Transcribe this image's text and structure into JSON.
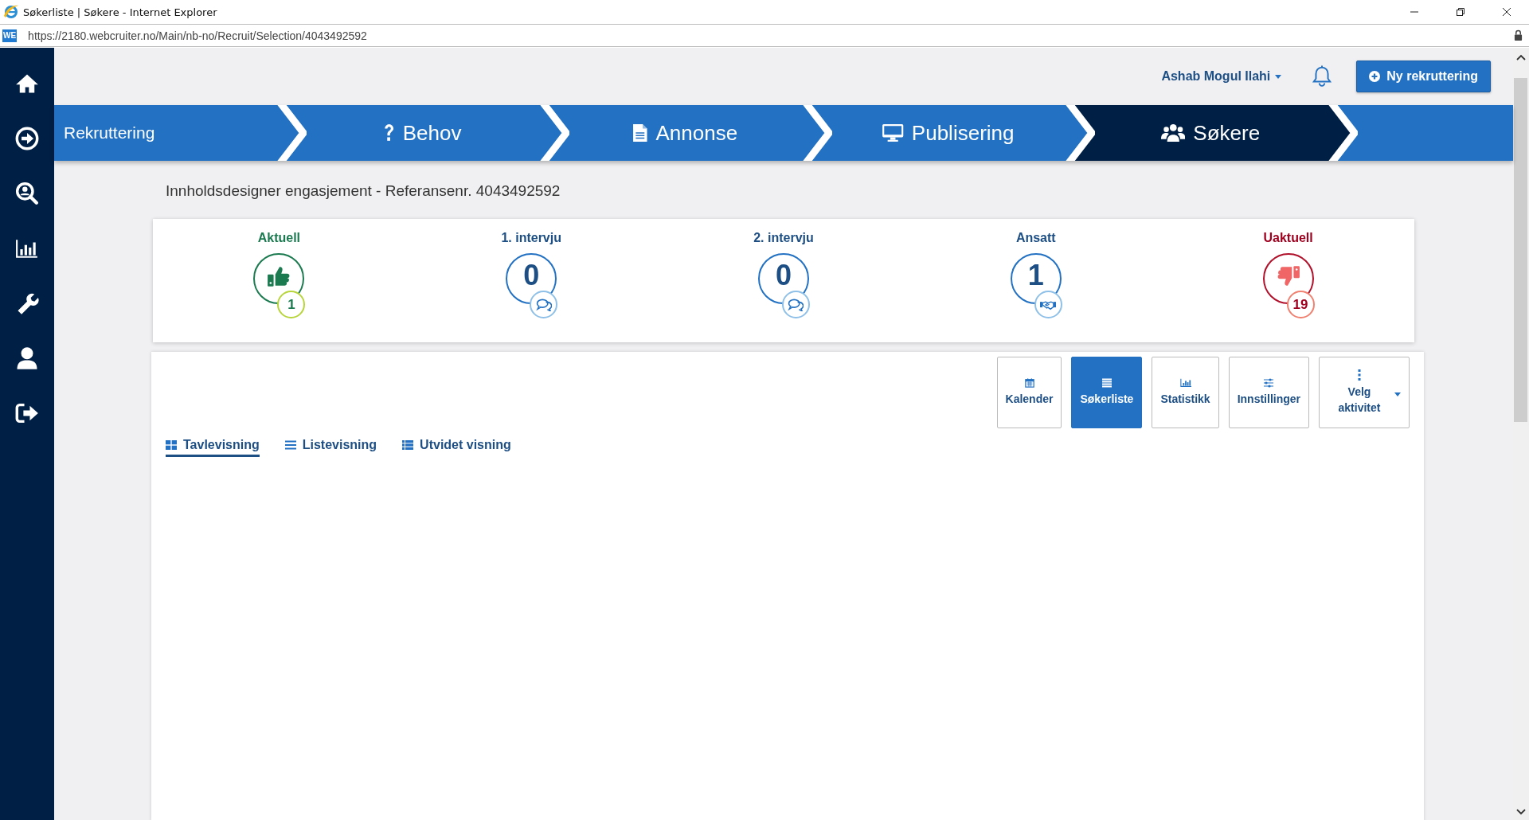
{
  "window": {
    "title": "Søkerliste | Søkere - Internet Explorer"
  },
  "address_bar": {
    "favicon": "WE",
    "url": "https://2180.webcruiter.no/Main/nb-no/Recruit/Selection/4043492592"
  },
  "header": {
    "user_name": "Ashab Mogul Ilahi",
    "new_button": "Ny rekruttering"
  },
  "pipeline": [
    {
      "label": "Rekruttering",
      "selected": false
    },
    {
      "label": "Behov",
      "selected": false
    },
    {
      "label": "Annonse",
      "selected": false
    },
    {
      "label": "Publisering",
      "selected": false
    },
    {
      "label": "Søkere",
      "selected": true
    }
  ],
  "page_title": "Innholdsdesigner engasjement - Referansenr. 4043492592",
  "stages": [
    {
      "label": "Aktuell",
      "kind": "positive",
      "value": "1",
      "color": "#1b7a4f"
    },
    {
      "label": "1. intervju",
      "kind": "interview",
      "value": "0",
      "color": "#1d4f85"
    },
    {
      "label": "2. intervju",
      "kind": "interview",
      "value": "0",
      "color": "#1d4f85"
    },
    {
      "label": "Ansatt",
      "kind": "hired",
      "value": "1",
      "color": "#1d4f85"
    },
    {
      "label": "Uaktuell",
      "kind": "negative",
      "value": "19",
      "color": "#a0001e"
    }
  ],
  "toolbar": [
    {
      "label": "Kalender",
      "selected": false,
      "kind": "button"
    },
    {
      "label": "Søkerliste",
      "selected": true,
      "kind": "button"
    },
    {
      "label": "Statistikk",
      "selected": false,
      "kind": "button"
    },
    {
      "label": "Innstillinger",
      "selected": false,
      "kind": "button"
    },
    {
      "label": "Velg aktivitet",
      "selected": false,
      "kind": "dropdown"
    }
  ],
  "view_tabs": [
    {
      "label": "Tavlevisning",
      "selected": true
    },
    {
      "label": "Listevisning",
      "selected": false
    },
    {
      "label": "Utvidet visning",
      "selected": false
    }
  ]
}
